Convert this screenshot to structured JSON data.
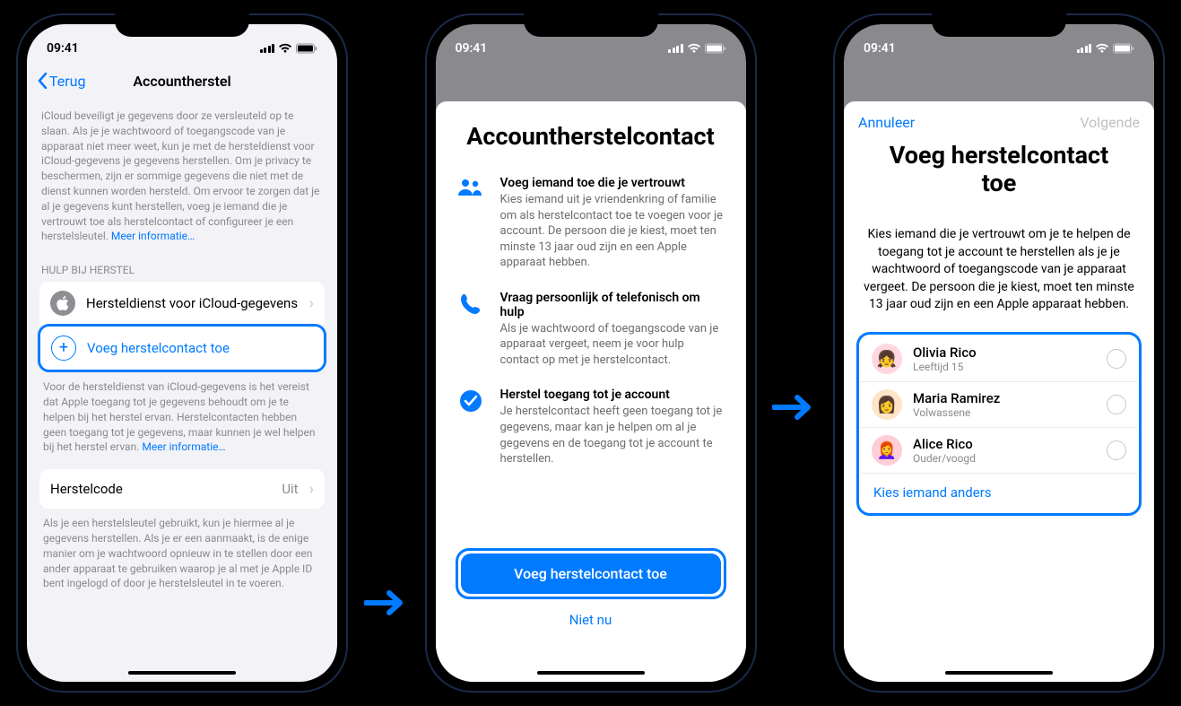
{
  "status": {
    "time": "09:41"
  },
  "screen1": {
    "back": "Terug",
    "title": "Accountherstel",
    "intro": "iCloud beveiligt je gegevens door ze versleuteld op te slaan. Als je je wachtwoord of toegangscode van je apparaat niet meer weet, kun je met de hersteldienst voor iCloud-gegevens je gegevens herstellen. Om je privacy te beschermen, zijn er sommige gegevens die niet met de dienst kunnen worden hersteld. Om ervoor te zorgen dat je al je gegevens kunt herstellen, voeg je iemand die je vertrouwt toe als herstelcontact of configureer je een herstelsleutel. ",
    "intro_link": "Meer informatie…",
    "section1_header": "HULP BIJ HERSTEL",
    "row_recovery_service": "Hersteldienst voor iCloud-gegevens",
    "row_add_contact": "Voeg herstelcontact toe",
    "footnote1": "Voor de hersteldienst van iCloud-gegevens is het vereist dat Apple toegang tot je gegevens behoudt om je te helpen bij het herstel ervan. Herstelcontacten hebben geen toegang tot je gegevens, maar kunnen je wel helpen bij het herstel ervan. ",
    "footnote1_link": "Meer informatie…",
    "row_recovery_key": "Herstelcode",
    "row_recovery_key_value": "Uit",
    "footnote2": "Als je een herstelsleutel gebruikt, kun je hiermee al je gegevens herstellen. Als je er een aanmaakt, is de enige manier om je wachtwoord opnieuw in te stellen door een ander apparaat te gebruiken waarop je al met je Apple ID bent ingelogd of door je herstelsleutel in te voeren."
  },
  "screen2": {
    "title": "Accountherstelcon­tact",
    "feat1_title": "Voeg iemand toe die je vertrouwt",
    "feat1_body": "Kies iemand uit je vriendenkring of familie om als herstelcontact toe te voegen voor je account. De persoon die je kiest, moet ten minste 13 jaar oud zijn en een Apple apparaat hebben.",
    "feat2_title": "Vraag persoonlijk of telefonisch om hulp",
    "feat2_body": "Als je wachtwoord of toegangscode van je apparaat vergeet, neem je voor hulp contact op met je herstelcontact.",
    "feat3_title": "Herstel toegang tot je account",
    "feat3_body": "Je herstelcontact heeft geen toegang tot je gegevens, maar kan je helpen om al je gegevens en de toegang tot je account te herstellen.",
    "primary_btn": "Voeg herstelcontact toe",
    "secondary": "Niet nu"
  },
  "screen3": {
    "cancel": "Annuleer",
    "next": "Volgende",
    "title": "Voeg herstel­contact toe",
    "subtitle": "Kies iemand die je vertrouwt om je te helpen de toegang tot je account te herstellen als je je wachtwoord of toegangscode van je apparaat vergeet. De persoon die je kiest, moet ten minste 13 jaar oud zijn en een Apple apparaat hebben.",
    "contacts": [
      {
        "name": "Olivia Rico",
        "meta": "Leeftijd 15"
      },
      {
        "name": "Maria Ramirez",
        "meta": "Volwassene"
      },
      {
        "name": "Alice Rico",
        "meta": "Ouder/voogd"
      }
    ],
    "choose_other": "Kies iemand anders"
  }
}
